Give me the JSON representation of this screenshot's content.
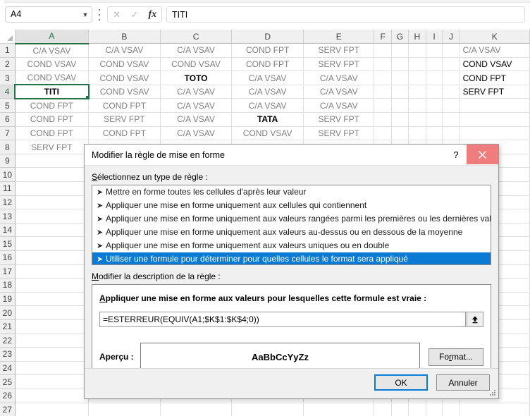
{
  "formula_bar": {
    "name_box_value": "A4",
    "cancel_icon": "close-x-icon",
    "confirm_icon": "checkmark-icon",
    "fx_label": "fx",
    "formula_value": "TITI"
  },
  "grid": {
    "columns": [
      "A",
      "B",
      "C",
      "D",
      "E",
      "F",
      "G",
      "H",
      "I",
      "J",
      "K"
    ],
    "selected_column": "A",
    "selected_row": 4,
    "active_cell": "A4",
    "row_count": 27,
    "rows": [
      {
        "n": 1,
        "A": "C/A VSAV",
        "B": "C/A VSAV",
        "C": "C/A VSAV",
        "D": "COND FPT",
        "E": "SERV FPT",
        "K": "C/A VSAV"
      },
      {
        "n": 2,
        "A": "COND VSAV",
        "B": "COND VSAV",
        "C": "COND VSAV",
        "D": "COND FPT",
        "E": "SERV FPT",
        "K": "COND VSAV"
      },
      {
        "n": 3,
        "A": "COND VSAV",
        "B": "COND VSAV",
        "C": "TOTO",
        "D": "C/A VSAV",
        "E": "C/A VSAV",
        "K": "COND FPT"
      },
      {
        "n": 4,
        "A": "TITI",
        "B": "COND VSAV",
        "C": "C/A VSAV",
        "D": "C/A VSAV",
        "E": "C/A VSAV",
        "K": "SERV FPT"
      },
      {
        "n": 5,
        "A": "COND FPT",
        "B": "COND FPT",
        "C": "C/A VSAV",
        "D": "C/A VSAV",
        "E": "C/A VSAV",
        "K": ""
      },
      {
        "n": 6,
        "A": "COND FPT",
        "B": "SERV FPT",
        "C": "C/A VSAV",
        "D": "TATA",
        "E": "SERV FPT",
        "K": ""
      },
      {
        "n": 7,
        "A": "COND FPT",
        "B": "COND FPT",
        "C": "C/A VSAV",
        "D": "COND VSAV",
        "E": "SERV FPT",
        "K": ""
      },
      {
        "n": 8,
        "A": "SERV FPT",
        "B": "",
        "C": "",
        "D": "",
        "E": "",
        "K": ""
      }
    ],
    "bold_black_cells": [
      "C3",
      "A4",
      "D6"
    ],
    "k_column_black": true
  },
  "dialog": {
    "title": "Modifier la règle de mise en forme",
    "help_icon": "question-mark-icon",
    "close_icon": "close-x-icon",
    "close_button_color": "#ef7d7d",
    "highlight_color": "#0a7bd4",
    "rule_type_label_prefix": "S",
    "rule_type_label_rest": "électionnez un type de règle :",
    "rule_types": [
      {
        "label": "Mettre en forme toutes les cellules d'après leur valeur",
        "selected": false
      },
      {
        "label": "Appliquer une mise en forme uniquement aux cellules qui contiennent",
        "selected": false
      },
      {
        "label": "Appliquer une mise en forme uniquement aux valeurs rangées parmi les premières ou les dernières valeurs",
        "selected": false
      },
      {
        "label": "Appliquer une mise en forme uniquement aux valeurs au-dessus ou en dessous de la moyenne",
        "selected": false
      },
      {
        "label": "Appliquer une mise en forme uniquement aux valeurs uniques ou en double",
        "selected": false
      },
      {
        "label": "Utiliser une formule pour déterminer pour quelles cellules le format sera appliqué",
        "selected": true
      }
    ],
    "bullet_glyph": "➤",
    "description_label_prefix": "M",
    "description_label_rest": "odifier la description de la règle :",
    "formula_prompt_prefix": "A",
    "formula_prompt_rest": "ppliquer une mise en forme aux valeurs pour lesquelles cette formule est vraie :",
    "formula_value": "=ESTERREUR(EQUIV(A1;$K$1:$K$4;0))",
    "collapse_icon": "collapse-dialog-arrow-icon",
    "preview_label": "Aperçu :",
    "preview_sample": "AaBbCcYyZz",
    "format_button_prefix": "Fo",
    "format_button_accel": "r",
    "format_button_suffix": "mat...",
    "ok_label": "OK",
    "cancel_label": "Annuler",
    "resize_grip_icon": "resize-grip-icon"
  }
}
